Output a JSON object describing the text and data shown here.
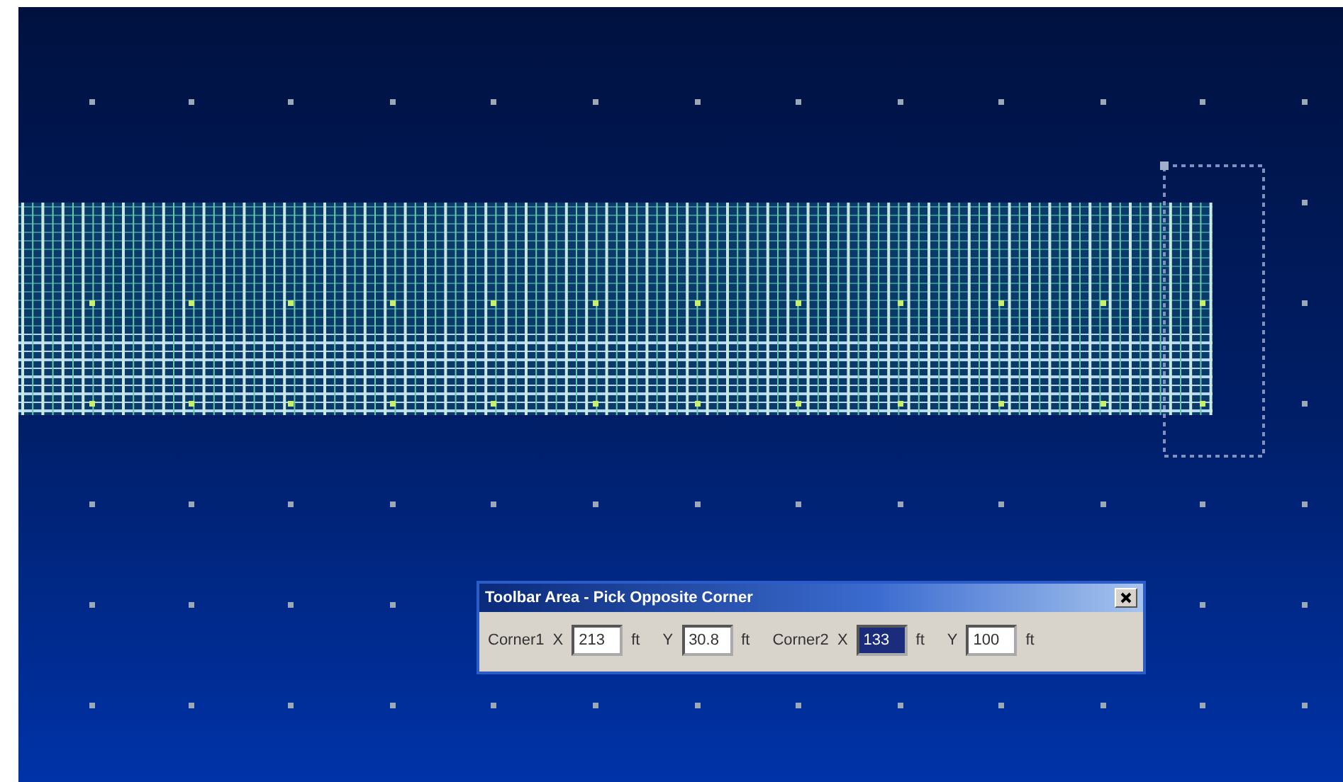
{
  "dialog": {
    "title": "Toolbar Area - Pick Opposite Corner",
    "corners": [
      {
        "label": "Corner1",
        "coords": [
          {
            "axis": "X",
            "value": "213",
            "unit": "ft",
            "selected": false
          },
          {
            "axis": "Y",
            "value": "30.8",
            "unit": "ft",
            "selected": false
          }
        ]
      },
      {
        "label": "Corner2",
        "coords": [
          {
            "axis": "X",
            "value": "133",
            "unit": "ft",
            "selected": true
          },
          {
            "axis": "Y",
            "value": "100",
            "unit": "ft",
            "selected": false
          }
        ]
      }
    ]
  }
}
